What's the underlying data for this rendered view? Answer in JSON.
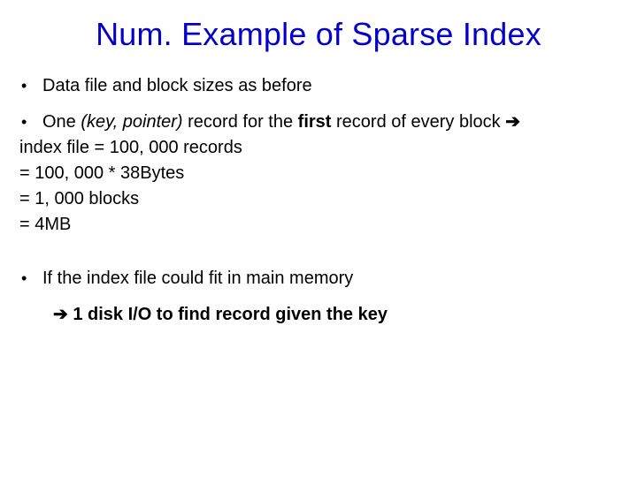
{
  "title": "Num. Example of Sparse Index",
  "bullet1": "Data file and block sizes as before",
  "bullet2_pre": "One ",
  "bullet2_italic": "(key, pointer)",
  "bullet2_mid": " record for the ",
  "bullet2_bold": "first",
  "bullet2_post": " record of every block ",
  "arrow": "➔",
  "calc1": "index file = 100, 000 records",
  "calc2": "= 100, 000 * 38Bytes",
  "calc3": "= 1, 000 blocks",
  "calc4": "= 4MB",
  "bullet3": "If the index file could fit in main memory",
  "conclusion": " 1 disk I/O to find record given the key"
}
